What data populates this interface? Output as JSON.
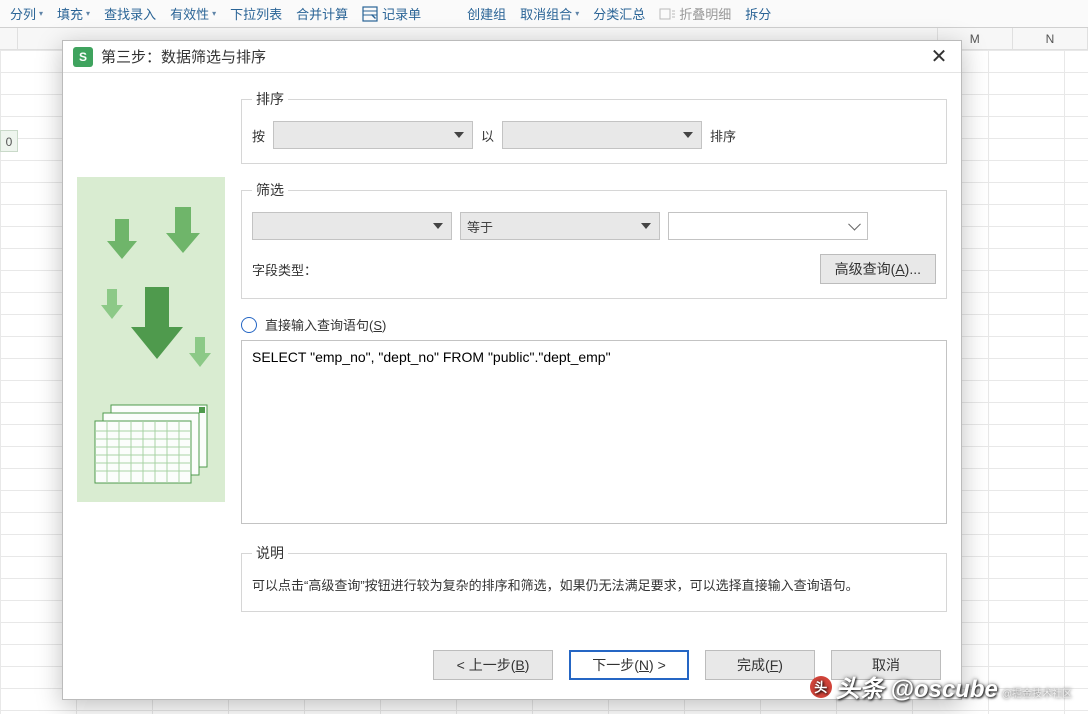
{
  "toolbar": {
    "items": [
      {
        "label": "分列",
        "caret": true
      },
      {
        "label": "填充",
        "caret": true
      },
      {
        "label": "查找录入",
        "caret": false
      },
      {
        "label": "有效性",
        "caret": true
      },
      {
        "label": "下拉列表",
        "caret": false
      },
      {
        "label": "合并计算",
        "caret": false
      },
      {
        "label": "记录单",
        "caret": false,
        "icon": true
      }
    ],
    "items2": [
      {
        "label": "创建组",
        "caret": false
      },
      {
        "label": "取消组合",
        "caret": true
      },
      {
        "label": "分类汇总",
        "caret": false
      },
      {
        "label": "折叠明细",
        "caret": false,
        "gray": true
      },
      {
        "label": "拆分",
        "caret": false,
        "partial": true
      }
    ]
  },
  "columns": [
    "",
    "M",
    "N"
  ],
  "row_label": "0",
  "dialog": {
    "title": "第三步：数据筛选与排序",
    "sort": {
      "legend": "排序",
      "by": "按",
      "then": "以",
      "order": "排序"
    },
    "filter": {
      "legend": "筛选",
      "op_label": "等于",
      "field_type_label": "字段类型：",
      "adv_btn": "高级查询(A)..."
    },
    "direct": {
      "radio_label": "直接输入查询语句(S)",
      "sql": "SELECT \"emp_no\", \"dept_no\" FROM \"public\".\"dept_emp\""
    },
    "desc": {
      "legend": "说明",
      "text": "可以点击“高级查询”按钮进行较为复杂的排序和筛选，如果仍无法满足要求，可以选择直接输入查询语句。"
    },
    "buttons": {
      "prev": "< 上一步(B)",
      "next": "下一步(N) >",
      "finish": "完成(F)",
      "cancel": "取消"
    }
  },
  "watermark": {
    "brand": "头条 @oscube",
    "sub": "@掘金技术社区",
    "dot": "头"
  }
}
